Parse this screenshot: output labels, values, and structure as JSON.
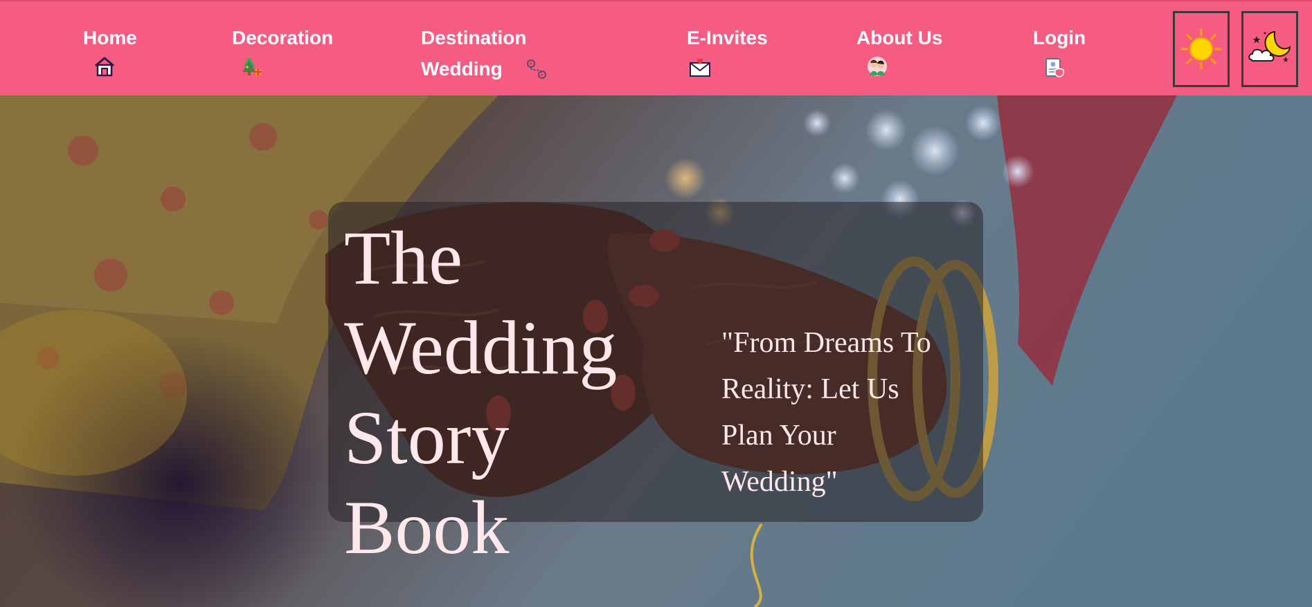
{
  "nav": {
    "items": [
      {
        "label": "Home",
        "icon": "house-icon"
      },
      {
        "label": "Decoration",
        "icon": "christmas-tree-gifts-icon"
      },
      {
        "label": "Destination Wedding",
        "icon": "travel-route-icon"
      },
      {
        "label": "E-Invites",
        "icon": "heart-envelope-icon"
      },
      {
        "label": "About Us",
        "icon": "couple-icon"
      },
      {
        "label": "Login",
        "icon": "id-card-icon"
      }
    ],
    "theme_buttons": [
      {
        "icon": "sun-icon"
      },
      {
        "icon": "moon-cloud-icon"
      }
    ],
    "colors": {
      "bar": "#f65b82",
      "text": "#ffffff"
    }
  },
  "hero": {
    "title": "The Wedding Story Book",
    "tagline": "\"From Dreams To Reality: Let Us Plan Your Wedding\"",
    "background": "wedding-hands-photo",
    "text_color": "#ffe8ec"
  }
}
